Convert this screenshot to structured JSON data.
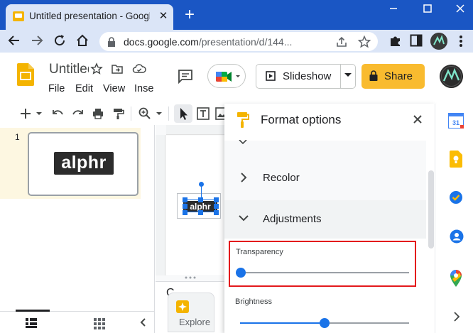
{
  "browser": {
    "tab_title": "Untitled presentation - Google Slides",
    "tab_close": "✕",
    "new_tab": "+",
    "url_host": "docs.google.com",
    "url_path": "/presentation/d/144..."
  },
  "slides": {
    "doc_title": "Untitled presentation",
    "menus": {
      "file": "File",
      "edit": "Edit",
      "view": "View",
      "insert": "Insert"
    },
    "slideshow_label": "Slideshow",
    "share_label": "Share",
    "slide_number": "1",
    "slide_logo_text": "alphr",
    "canvas_logo_text": "alphr",
    "notes_text": "C",
    "explore_label": "Explore"
  },
  "format_panel": {
    "title": "Format options",
    "recolor_label": "Recolor",
    "adjustments_label": "Adjustments",
    "transparency_label": "Transparency",
    "transparency_value": 0,
    "brightness_label": "Brightness",
    "brightness_value": 0.5
  },
  "colors": {
    "chrome_blue": "#1a56c4",
    "share_yellow": "#f9bb2f",
    "slider_blue": "#1a73e8",
    "highlight_red": "#e3191c"
  }
}
